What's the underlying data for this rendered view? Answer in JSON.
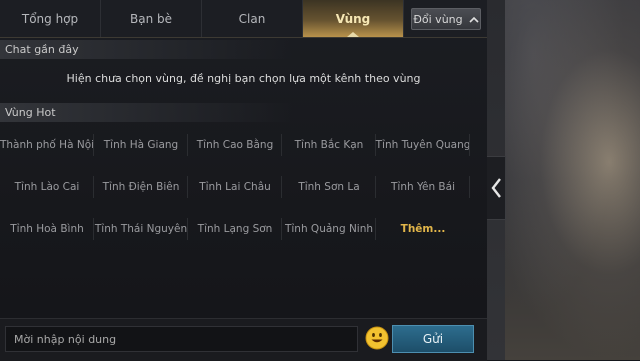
{
  "tabs": [
    "Tổng hợp",
    "Bạn bè",
    "Clan",
    "Vùng"
  ],
  "region_button": {
    "label": "Đổi vùng",
    "icon": "chevron-up-icon"
  },
  "recent_chat": {
    "heading": "Chat gần đây",
    "notice": "Hiện chưa chọn vùng, đề nghị bạn chọn lựa một kênh theo vùng"
  },
  "hot_regions": {
    "heading": "Vùng Hot",
    "items": [
      "Thành phố Hà Nội",
      "Tỉnh Hà Giang",
      "Tỉnh Cao Bằng",
      "Tỉnh Bắc Kạn",
      "Tỉnh Tuyên Quang",
      "Tỉnh Lào Cai",
      "Tỉnh Điện Biên",
      "Tỉnh Lai Châu",
      "Tỉnh Sơn La",
      "Tỉnh Yên Bái",
      "Tỉnh Hoà Bình",
      "Tỉnh Thái Nguyên",
      "Tỉnh Lạng Sơn",
      "Tỉnh Quảng Ninh"
    ],
    "more_label": "Thêm..."
  },
  "composer": {
    "placeholder": "Mời nhập nội dung",
    "send_label": "Gửi",
    "emoji_icon": "smiley-icon"
  },
  "side_toggle_icon": "chevron-left-icon",
  "colors": {
    "accent": "#e2b64a",
    "active_tab_text": "#f6e7b4",
    "send": "#2d6d8e"
  }
}
